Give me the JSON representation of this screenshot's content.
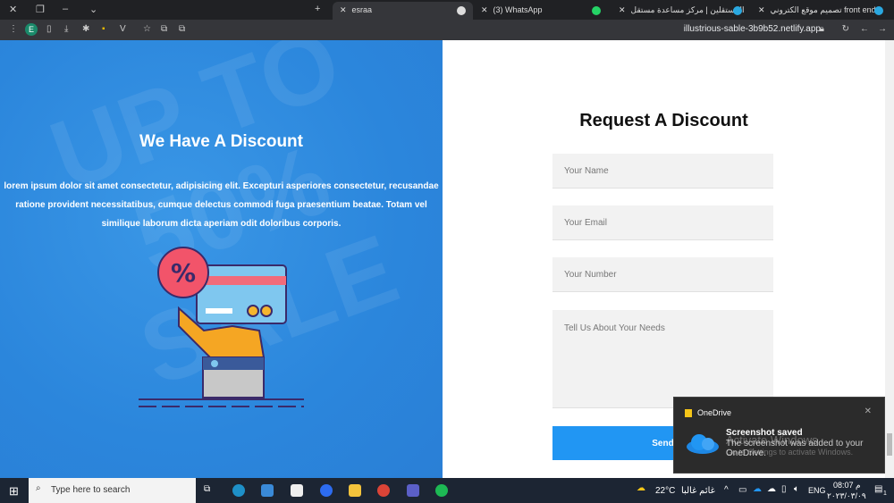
{
  "browser": {
    "tabs": [
      {
        "label": "esraa",
        "active": true
      },
      {
        "label": "(3) WhatsApp"
      },
      {
        "label": "المستقلين | مركز مساعدة مستقل"
      },
      {
        "label": "تصميم موقع الكتروني front end |"
      }
    ],
    "new_tab": "+",
    "profile_initial": "E",
    "url": "illustrious-sable-3b9b52.netlify.app"
  },
  "left": {
    "title": "We Have A Discount",
    "text": "lorem ipsum dolor sit amet consectetur, adipisicing elit. Excepturi asperiores consectetur, recusandae ratione provident necessitatibus, cumque delectus commodi fuga praesentium beatae. Totam vel similique laborum dicta aperiam odit doloribus corporis.",
    "bg_text": "UP TO 50% SALE",
    "percent_symbol": "%"
  },
  "form": {
    "title": "Request A Discount",
    "name_placeholder": "Your Name",
    "email_placeholder": "Your Email",
    "number_placeholder": "Your Number",
    "needs_placeholder": "Tell Us About Your Needs",
    "send_label": "Send"
  },
  "toast": {
    "app": "OneDrive",
    "title": "Screenshot saved",
    "body": "The screenshot was added to your OneDrive.",
    "watermark1": "Activate Windows",
    "watermark2": "Go to Settings to activate Windows."
  },
  "taskbar": {
    "search_placeholder": "Type here to search",
    "weather": "22°C",
    "weather_text": "غائم غالبا",
    "lang": "ENG",
    "time": "08:07 م",
    "date": "٢٠٢٣/٠٣/٠٩",
    "notif_count": "1"
  },
  "colors": {
    "accent": "#2196f3",
    "panel": "#2d8ee0"
  }
}
